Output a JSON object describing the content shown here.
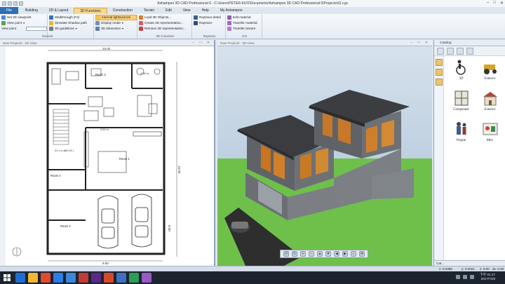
{
  "window": {
    "title": "Ashampoo 3D CAD Professional 6 - C:\\Users\\PETER-KUO\\Documents\\Ashampoo 3D CAD Professional 6\\Projects\\d1.cyp"
  },
  "menu": {
    "items": [
      "File",
      "Building",
      "2D & Layout",
      "3D Functions",
      "Construction",
      "Terrain",
      "Edit",
      "View",
      "Help",
      "My Ashampoo"
    ],
    "active": "3D Functions"
  },
  "ribbon": {
    "general": {
      "label": "General",
      "items": [
        "Set 3D viewpoint",
        "View point",
        "View point"
      ]
    },
    "visual": {
      "items": [
        "Walkthrough (F2)",
        "Simulate Shadow path",
        "3D guidelines"
      ]
    },
    "display": {
      "items": [
        "Internal lightsources",
        "Display mode",
        "3D dimension"
      ]
    },
    "converter": {
      "label": "3D Converter",
      "items": [
        "Load 3D Objects...",
        "Create 2D representation...",
        "Remove 2D representation..."
      ]
    },
    "raytrace": {
      "label": "Raytrace",
      "items": [
        "Raytrace detail",
        "Raytrace"
      ]
    },
    "edit3d": {
      "label": "3-D",
      "items": [
        "Edit material",
        "Transfer material",
        "Transfer texture"
      ]
    }
  },
  "view2d": {
    "header": "New Project3 - 2D View",
    "labels": {
      "dim_top": "10.00",
      "dim_bottom": "9.50",
      "dim_right": "10.00",
      "dim_right2": "8.00",
      "room1": "Room 1",
      "room2": "Room 2",
      "room3": "Room 3",
      "room4": "Room 4",
      "stair": "4.00 m",
      "area1": "21.1 m (69.4 ft )",
      "dim_mid": "9.00 m"
    }
  },
  "view3d": {
    "header": "New Project3 - 3D-View"
  },
  "catalog": {
    "tab": "Catalog",
    "items": [
      {
        "label": "3D",
        "icon": "wheelchair-icon"
      },
      {
        "label": "Exterior",
        "icon": "tractor-icon"
      },
      {
        "label": "Component",
        "icon": "window-icon"
      },
      {
        "label": "Exterior",
        "icon": "building-icon"
      },
      {
        "label": "People",
        "icon": "people-icon"
      },
      {
        "label": "Misc",
        "icon": "misc-icon"
      }
    ],
    "bottom_tab": "Cat..."
  },
  "status": {
    "x": "x: 0.0396",
    "y": "y: 0.0021",
    "z": "z: 0.00",
    "dx": "dx: 0.00"
  },
  "taskbar": {
    "time": "下午 01:17",
    "date": "2017/7/29",
    "icon_colors": [
      "#1e6fd1",
      "#f2b632",
      "#e04a2f",
      "#2d7de3",
      "#3a88d9",
      "#c23b34",
      "#5b2a86",
      "#d64a2a",
      "#3f6fc2",
      "#2c9d57",
      "#9c58c4"
    ]
  }
}
